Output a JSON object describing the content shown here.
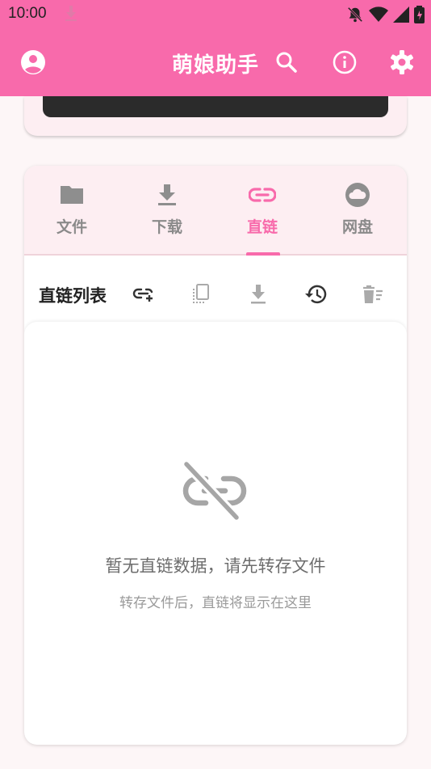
{
  "status_bar": {
    "time": "10:00"
  },
  "app_bar": {
    "title": "萌娘助手",
    "icons": [
      "account-icon",
      "search-icon",
      "info-icon",
      "settings-icon"
    ]
  },
  "tabs": [
    {
      "label": "文件",
      "icon": "folder-icon",
      "active": false
    },
    {
      "label": "下载",
      "icon": "download-icon",
      "active": false
    },
    {
      "label": "直链",
      "icon": "link-icon",
      "active": true
    },
    {
      "label": "网盘",
      "icon": "cloud-icon",
      "active": false
    }
  ],
  "toolbar": {
    "title": "直链列表",
    "actions": [
      "add-link-icon",
      "copy-icon",
      "download-icon",
      "history-icon",
      "clear-list-icon"
    ]
  },
  "empty_state": {
    "icon": "link-off-icon",
    "title": "暂无直链数据，请先转存文件",
    "subtitle": "转存文件后，直链将显示在这里"
  },
  "colors": {
    "primary": "#f86aab",
    "tab_bg": "#fdeef2",
    "inactive": "#8a8a8a"
  }
}
